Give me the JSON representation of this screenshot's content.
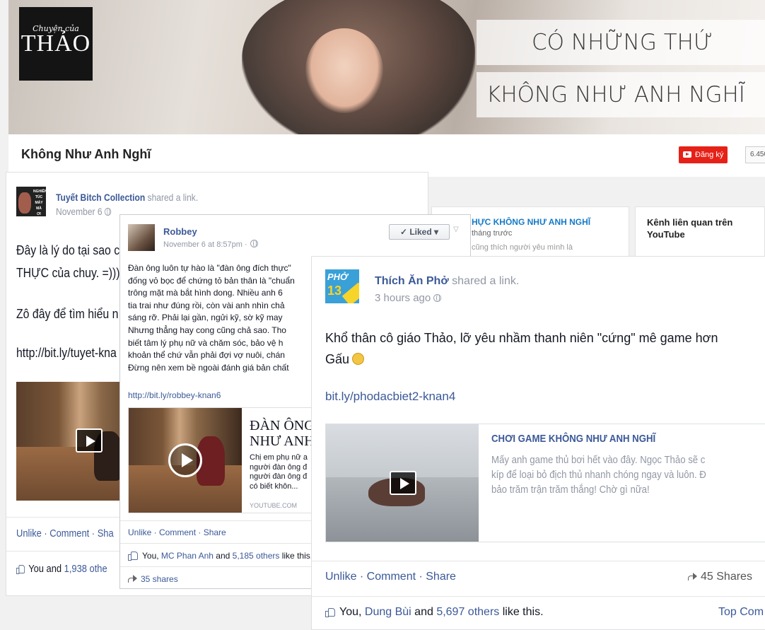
{
  "channel": {
    "banner_logo_small": "Chuyện của",
    "banner_logo_big": "THẢO",
    "banner_line1": "CÓ NHỮNG THỨ",
    "banner_line2": "KHÔNG NHƯ ANH NGHĨ",
    "title": "Không Như Anh Nghĩ",
    "subscribe_label": "Đăng ký",
    "subscriber_count": "6.450",
    "card1_title": "HỰC KHÔNG NHƯ ANH NGHĨ",
    "card1_sub": "tháng trước",
    "card1_faded": "cũng thích người yêu mình là",
    "card2_title": "Kênh liên quan trên",
    "card2_sub": "YouTube"
  },
  "post1": {
    "avatar_text": [
      "NGHIÊN",
      "TÚC",
      "MÁY",
      "MÀ",
      "ƠI"
    ],
    "author": "Tuyết Bitch Collection",
    "action": " shared a link.",
    "date": "November 6",
    "text_line1": "Đây là lý do tại sao c",
    "text_line2": "THỰC của chuy. =)))",
    "text_line3": "Zô đây để tìm hiểu n",
    "link": "http://bit.ly/tuyet-kna",
    "actions": "Unlike · Comment · Sha",
    "likes_prefix": "You and ",
    "likes_count": "1,938 othe"
  },
  "post2": {
    "author": "Robbey",
    "date": "November 6 at 8:57pm ·",
    "liked_label": "✓ Liked ▾",
    "body": [
      "Đàn ông luôn tự hào là \"đàn ông đích thực\"",
      "đống vỏ bọc để chứng tỏ bản thân là \"chuẩn",
      "trông mặt mà bắt hình dong. Nhiều anh 6",
      "tia trai như đúng rồi, còn vài anh nhìn chả",
      "sáng rỡ. Phải lại gần, ngửi kỹ, sờ kỹ may",
      "Nhưng thẳng hay cong cũng chả sao. Tho",
      "biết tâm lý phụ nữ và chăm sóc, bảo vệ h",
      "khoản thể chứ vẫn phải đợi vợ nuôi, chán",
      "Đừng nên xem bề ngoài đánh giá bản chất"
    ],
    "link": "http://bit.ly/robbey-knan6",
    "att_title_line1": "ĐÀN ÔNG",
    "att_title_line2": "NHƯ ANH",
    "att_desc": [
      "Chị em phụ nữ a",
      "người đàn ông đ",
      "người đàn ông đ",
      "có biết khôn..."
    ],
    "att_source": "YOUTUBE.COM",
    "actions": "Unlike · Comment · Share",
    "likes_prefix": "You, ",
    "likes_name": "MC Phan Anh",
    "likes_mid": " and ",
    "likes_others": "5,185 others",
    "likes_suffix": " like this.",
    "shares": "35 shares"
  },
  "post3": {
    "avatar_pho": "PHỞ",
    "avatar_num": "13",
    "author": "Thích Ăn Phở",
    "action": " shared a link.",
    "date": "3 hours ago",
    "text_line1": "Khổ thân cô giáo Thảo, lỡ yêu nhầm thanh niên \"cứng\" mê game hơn",
    "text_line2": "Gấu",
    "link": "bit.ly/phodacbiet2-knan4",
    "att_title": "CHƠI GAME KHÔNG NHƯ ANH NGHĨ",
    "att_desc_line1": "Mấy anh game thủ bơi hết vào đây. Ngọc Thảo sẽ c",
    "att_desc_line2": "kíp để loại bỏ địch thủ nhanh chóng ngay và luôn. Đ",
    "att_desc_line3": "bảo trăm trận trăm thắng! Chờ gì nữa!",
    "actions": "Unlike · Comment · Share",
    "shares": "45 Shares",
    "likes_prefix": "You, ",
    "likes_name": "Dung Bùi",
    "likes_mid": " and ",
    "likes_others": "5,697 others",
    "likes_suffix": " like this.",
    "top_comments": "Top Com"
  },
  "icons": [
    "globe-icon",
    "like-thumb-icon",
    "share-arrow-icon",
    "play-icon",
    "youtube-logo-icon",
    "smile-emoji-icon"
  ],
  "colors": {
    "facebook_blue": "#3b5998",
    "youtube_red": "#e62117",
    "muted_gray": "#9197a3"
  }
}
